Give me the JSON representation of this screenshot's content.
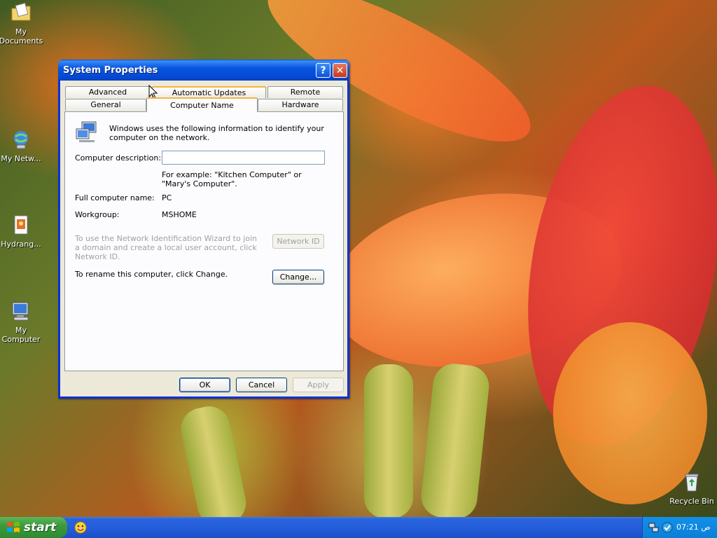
{
  "desktop": {
    "icons": [
      {
        "label": "My Documents",
        "icon": "folder-documents-icon"
      },
      {
        "label": "My Netw...",
        "icon": "network-places-icon"
      },
      {
        "label": "Hydrang...",
        "icon": "image-file-icon"
      },
      {
        "label": "My Computer",
        "icon": "computer-icon"
      },
      {
        "label": "Recycle Bin",
        "icon": "recycle-bin-icon"
      }
    ]
  },
  "window": {
    "title": "System Properties",
    "help_icon": "?",
    "close_icon": "✕",
    "tabs_row1": [
      "Advanced",
      "Automatic Updates",
      "Remote"
    ],
    "tabs_row2": [
      "General",
      "Computer Name",
      "Hardware"
    ],
    "active_tab": "Computer Name",
    "intro": "Windows uses the following information to identify your computer on the network.",
    "description_label": "Computer description:",
    "description_value": "",
    "example": "For example: \"Kitchen Computer\" or \"Mary's Computer\".",
    "full_name_label": "Full computer name:",
    "full_name_value": "PC",
    "workgroup_label": "Workgroup:",
    "workgroup_value": "MSHOME",
    "network_id_text": "To use the Network Identification Wizard to join a domain and create a local user account, click Network ID.",
    "network_id_button": "Network ID",
    "rename_text": "To rename this computer, click Change.",
    "change_button": "Change...",
    "ok_button": "OK",
    "cancel_button": "Cancel",
    "apply_button": "Apply"
  },
  "taskbar": {
    "start_label": "start",
    "quicklaunch_icon": "messenger-icon",
    "tray_time": "07:21 ص"
  }
}
